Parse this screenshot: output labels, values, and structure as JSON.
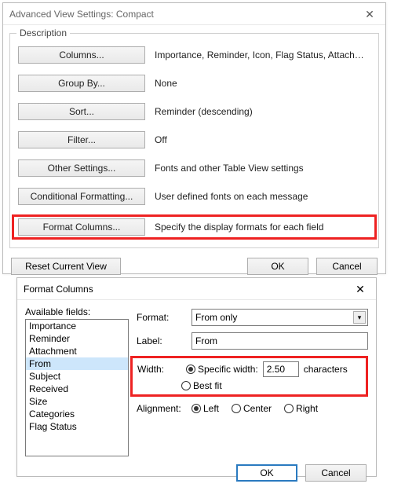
{
  "dialog1": {
    "title": "Advanced View Settings: Compact",
    "desc_legend": "Description",
    "rows": [
      {
        "btn": "Columns...",
        "desc": "Importance, Reminder, Icon, Flag Status, Attachment, Fr..."
      },
      {
        "btn": "Group By...",
        "desc": "None"
      },
      {
        "btn": "Sort...",
        "desc": "Reminder (descending)"
      },
      {
        "btn": "Filter...",
        "desc": "Off"
      },
      {
        "btn": "Other Settings...",
        "desc": "Fonts and other Table View settings"
      },
      {
        "btn": "Conditional Formatting...",
        "desc": "User defined fonts on each message"
      },
      {
        "btn": "Format Columns...",
        "desc": "Specify the display formats for each field"
      }
    ],
    "reset": "Reset Current View",
    "ok": "OK",
    "cancel": "Cancel"
  },
  "dialog2": {
    "title": "Format Columns",
    "avail_label": "Available fields:",
    "fields": [
      "Importance",
      "Reminder",
      "Attachment",
      "From",
      "Subject",
      "Received",
      "Size",
      "Categories",
      "Flag Status"
    ],
    "selected_field": "From",
    "format_label": "Format:",
    "format_value": "From only",
    "label_label": "Label:",
    "label_value": "From",
    "width_label": "Width:",
    "specific_label": "Specific width:",
    "width_value": "2.50",
    "chars_label": "characters",
    "bestfit_label": "Best fit",
    "align_label": "Alignment:",
    "left": "Left",
    "center": "Center",
    "right": "Right",
    "ok": "OK",
    "cancel": "Cancel"
  }
}
